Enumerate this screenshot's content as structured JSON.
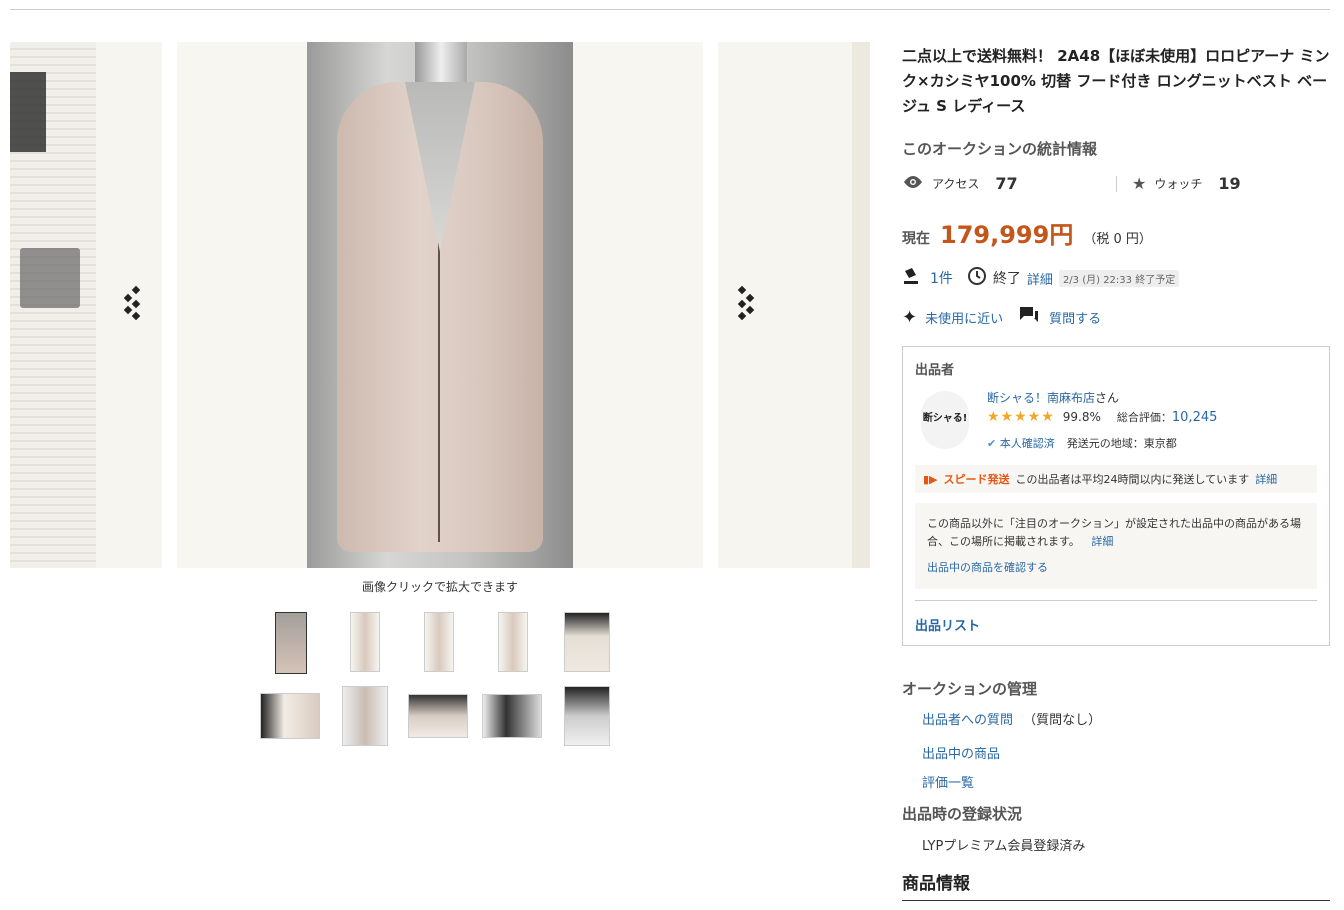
{
  "gallery": {
    "hint": "画像クリックで拡大できます",
    "thumb_count": 10
  },
  "item": {
    "title": "二点以上で送料無料！ 2A48【ほぼ未使用】ロロピアーナ ミンク×カシミヤ100% 切替 フード付き ロングニットベスト ベージュ S レディース"
  },
  "stats": {
    "heading": "このオークションの統計情報",
    "access_label": "アクセス",
    "access_value": "77",
    "watch_label": "ウォッチ",
    "watch_value": "19"
  },
  "price": {
    "label": "現在",
    "value": "179,999円",
    "tax": "（税 0 円）"
  },
  "bids": {
    "count": "1件",
    "status": "終了",
    "detail": "詳細",
    "end": "2/3 (月) 22:33 終了予定"
  },
  "tags": {
    "condition": "未使用に近い",
    "question": "質問する"
  },
  "seller": {
    "heading": "出品者",
    "avatar_text": "断シャる!",
    "name": "断シャる！南麻布店",
    "suffix": "さん",
    "rating_pct": "99.8%",
    "total_label": "総合評価：",
    "total_value": "10,245",
    "verified": "本人確認済",
    "region": "発送元の地域：東京都",
    "speed_label": "スピード発送",
    "speed_text": "この出品者は平均24時間以内に発送しています",
    "speed_detail": "詳細",
    "notice_text": "この商品以外に「注目のオークション」が設定された出品中の商品がある場合、この場所に掲載されます。",
    "notice_detail": "詳細",
    "notice_link": "出品中の商品を確認する",
    "list_link": "出品リスト"
  },
  "management": {
    "heading": "オークションの管理",
    "question_link": "出品者への質問",
    "question_note": "（質問なし）",
    "items_link": "出品中の商品",
    "ratings_link": "評価一覧"
  },
  "registration": {
    "heading": "出品時の登録状況",
    "status": "LYPプレミアム会員登録済み"
  },
  "product_info": {
    "heading": "商品情報"
  }
}
